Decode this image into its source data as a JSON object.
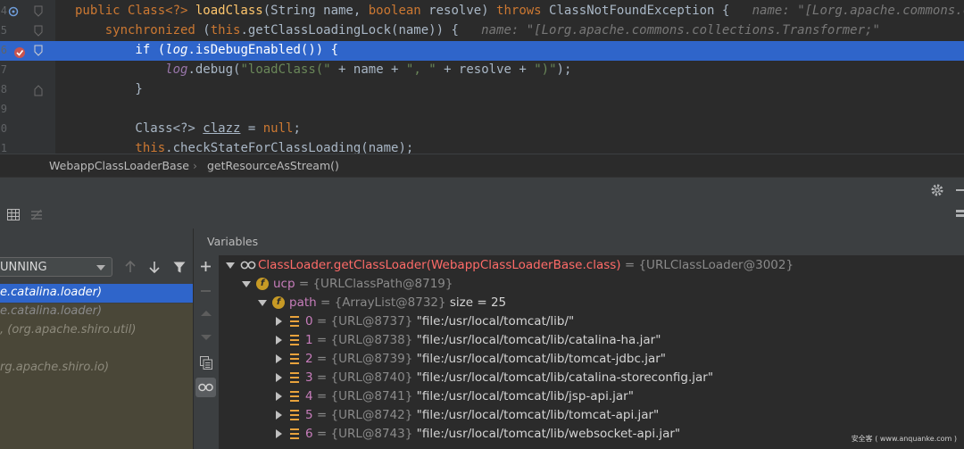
{
  "editor": {
    "lines": [
      {
        "num": "4",
        "tokens": [
          {
            "t": "public Class<?> ",
            "c": "kw"
          },
          {
            "t": "loadClass",
            "c": "fn"
          },
          {
            "t": "(String name, "
          },
          {
            "t": "boolean ",
            "c": "kw"
          },
          {
            "t": "resolve) "
          },
          {
            "t": "throws ",
            "c": "kw"
          },
          {
            "t": "ClassNotFoundException { "
          },
          {
            "t": "  name: \"[Lorg.apache.commons.c",
            "c": "hint"
          }
        ]
      },
      {
        "num": "5",
        "tokens": [
          {
            "t": "    synchronized",
            "c": "kw"
          },
          {
            "t": " ("
          },
          {
            "t": "this",
            "c": "kw"
          },
          {
            "t": ".getClassLoadingLock(name)) {  "
          },
          {
            "t": " name: \"[Lorg.apache.commons.collections.Transformer;\"",
            "c": "hint"
          }
        ]
      },
      {
        "num": "6",
        "tokens": [
          {
            "t": "        if ",
            "c": "kw"
          },
          {
            "t": "("
          },
          {
            "t": "log",
            "c": "fld"
          },
          {
            "t": ".isDebugEnabled()) {"
          }
        ]
      },
      {
        "num": "7",
        "tokens": [
          {
            "t": "            "
          },
          {
            "t": "log",
            "c": "fld"
          },
          {
            "t": ".debug("
          },
          {
            "t": "\"loadClass(\"",
            "c": "str"
          },
          {
            "t": " + name + "
          },
          {
            "t": "\", \"",
            "c": "str"
          },
          {
            "t": " + resolve + "
          },
          {
            "t": "\")\"",
            "c": "str"
          },
          {
            "t": ");"
          }
        ]
      },
      {
        "num": "8",
        "tokens": [
          {
            "t": "        }"
          }
        ]
      },
      {
        "num": "9",
        "tokens": []
      },
      {
        "num": "0",
        "tokens": [
          {
            "t": "        Class<?> "
          },
          {
            "t": "clazz",
            "c": "ul"
          },
          {
            "t": " = "
          },
          {
            "t": "null",
            "c": "kw"
          },
          {
            "t": ";"
          }
        ]
      },
      {
        "num": "1",
        "tokens": [
          {
            "t": "        this",
            "c": "kw"
          },
          {
            "t": ".checkStateForClassLoading(name);"
          }
        ]
      }
    ]
  },
  "breadcrumb": {
    "class": "WebappClassLoaderBase",
    "separator": "›",
    "method": "getResourceAsStream()"
  },
  "frames": {
    "thread_value": "UNNING",
    "items": [
      {
        "label": "e.catalina.loader)",
        "state": "selected"
      },
      {
        "label": "e.catalina.loader)",
        "state": "normal"
      },
      {
        "label": ", (org.apache.shiro.util)",
        "state": "lib"
      },
      {
        "label": "",
        "state": "lib"
      },
      {
        "label": "rg.apache.shiro.io)",
        "state": "lib"
      }
    ]
  },
  "variables": {
    "title": "Variables",
    "rows": [
      {
        "level": 0,
        "expand": "down",
        "icon": "watch",
        "name": "ClassLoader.getClassLoader(WebappClassLoaderBase.class)",
        "name_color": "red",
        "eq": " = ",
        "type": "{URLClassLoader@3002}",
        "extra": ""
      },
      {
        "level": 1,
        "expand": "down",
        "icon": "field",
        "name": "ucp",
        "name_color": "pur",
        "eq": " = ",
        "type": "{URLClassPath@8719}",
        "extra": ""
      },
      {
        "level": 2,
        "expand": "down",
        "icon": "field",
        "name": "path",
        "name_color": "pur",
        "eq": " = ",
        "type": "{ArrayList@8732}",
        "extra": "  size = 25"
      },
      {
        "level": 3,
        "expand": "right",
        "icon": "array",
        "name": "0",
        "name_color": "pur",
        "eq": " = ",
        "type": "{URL@8737}",
        "extra": " \"file:/usr/local/tomcat/lib/\""
      },
      {
        "level": 3,
        "expand": "right",
        "icon": "array",
        "name": "1",
        "name_color": "pur",
        "eq": " = ",
        "type": "{URL@8738}",
        "extra": " \"file:/usr/local/tomcat/lib/catalina-ha.jar\""
      },
      {
        "level": 3,
        "expand": "right",
        "icon": "array",
        "name": "2",
        "name_color": "pur",
        "eq": " = ",
        "type": "{URL@8739}",
        "extra": " \"file:/usr/local/tomcat/lib/tomcat-jdbc.jar\""
      },
      {
        "level": 3,
        "expand": "right",
        "icon": "array",
        "name": "3",
        "name_color": "pur",
        "eq": " = ",
        "type": "{URL@8740}",
        "extra": " \"file:/usr/local/tomcat/lib/catalina-storeconfig.jar\""
      },
      {
        "level": 3,
        "expand": "right",
        "icon": "array",
        "name": "4",
        "name_color": "pur",
        "eq": " = ",
        "type": "{URL@8741}",
        "extra": " \"file:/usr/local/tomcat/lib/jsp-api.jar\""
      },
      {
        "level": 3,
        "expand": "right",
        "icon": "array",
        "name": "5",
        "name_color": "pur",
        "eq": " = ",
        "type": "{URL@8742}",
        "extra": " \"file:/usr/local/tomcat/lib/tomcat-api.jar\""
      },
      {
        "level": 3,
        "expand": "right",
        "icon": "array",
        "name": "6",
        "name_color": "pur",
        "eq": " = ",
        "type": "{URL@8743}",
        "extra": " \"file:/usr/local/tomcat/lib/websocket-api.jar\""
      }
    ]
  },
  "watermark": "安全客 ( www.anquanke.com )",
  "colors": {
    "selection": "#2f65ca",
    "editor_bg": "#2b2b2b",
    "panel_bg": "#3c3f41"
  }
}
